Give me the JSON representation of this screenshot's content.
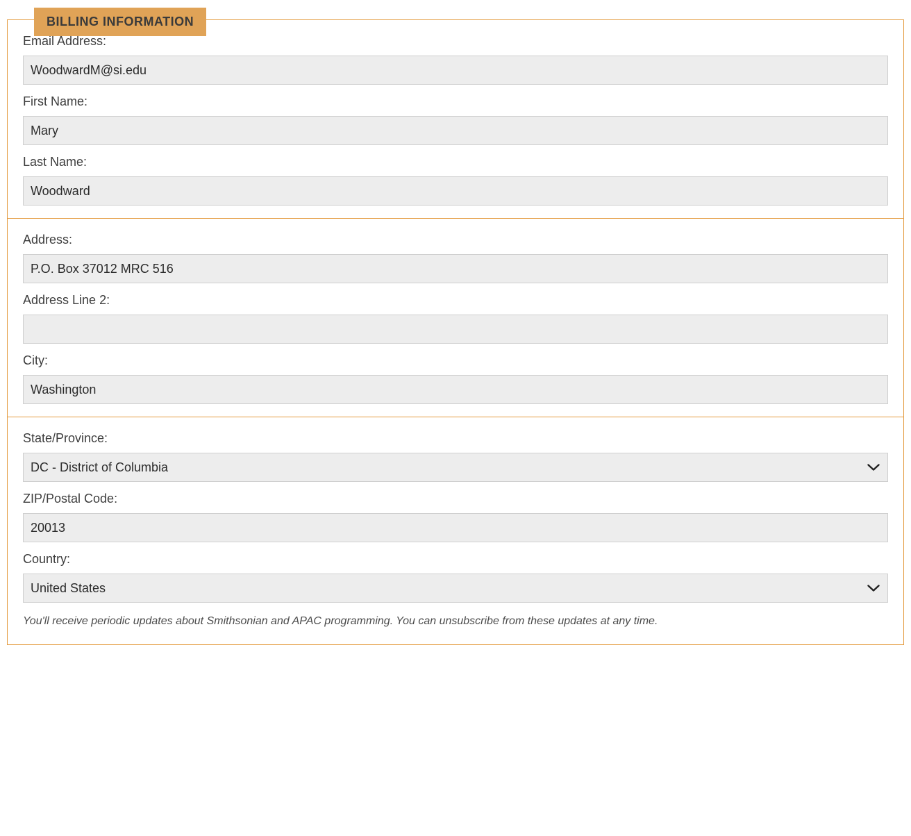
{
  "billing": {
    "legend": "BILLING INFORMATION",
    "email": {
      "label": "Email Address:",
      "value": "WoodwardM@si.edu"
    },
    "first_name": {
      "label": "First Name:",
      "value": "Mary"
    },
    "last_name": {
      "label": "Last Name:",
      "value": "Woodward"
    },
    "address": {
      "label": "Address:",
      "value": "P.O. Box 37012 MRC 516"
    },
    "address2": {
      "label": "Address Line 2:",
      "value": ""
    },
    "city": {
      "label": "City:",
      "value": "Washington"
    },
    "state": {
      "label": "State/Province:",
      "value": "DC - District of Columbia"
    },
    "zip": {
      "label": "ZIP/Postal Code:",
      "value": "20013"
    },
    "country": {
      "label": "Country:",
      "value": "United States"
    },
    "note": "You'll receive periodic updates about Smithsonian and APAC programming. You can unsubscribe from these updates at any time."
  }
}
